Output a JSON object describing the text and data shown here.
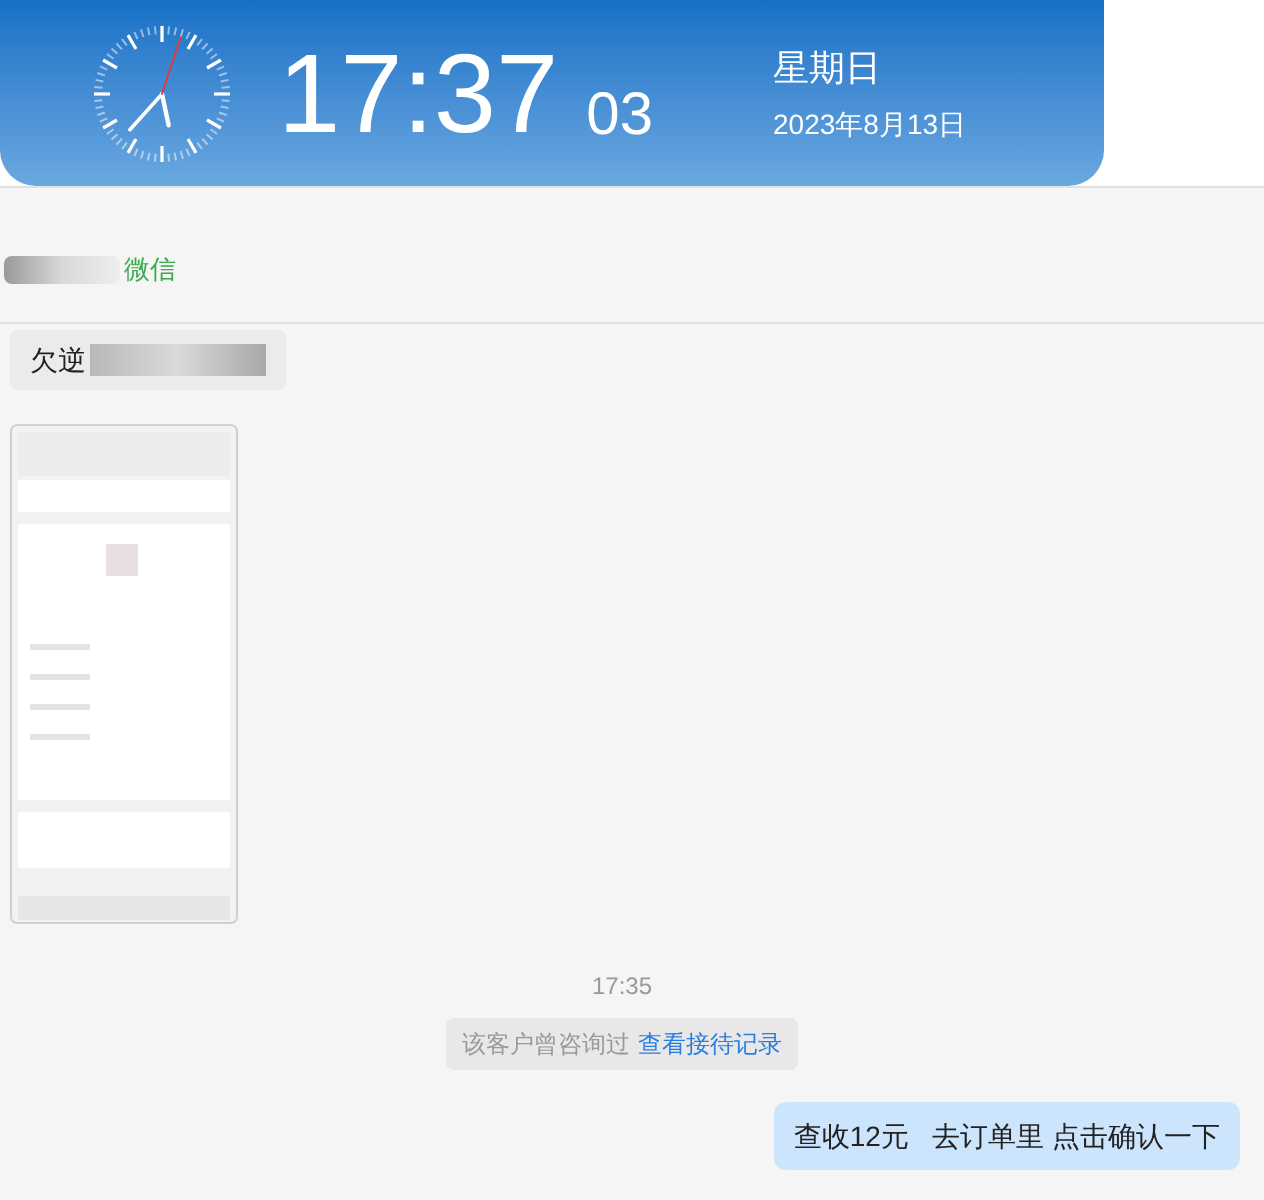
{
  "clock": {
    "time": "17:37",
    "seconds": "03",
    "weekday": "星期日",
    "date": "2023年8月13日"
  },
  "contact": {
    "channel": "微信"
  },
  "messages": [
    {
      "kind": "text_in",
      "text": "欠逆"
    },
    {
      "kind": "picture"
    },
    {
      "kind": "time",
      "text": "17:35"
    },
    {
      "kind": "notice",
      "text": "该客户曾咨询过",
      "link": "查看接待记录"
    },
    {
      "kind": "text_out",
      "text": "查收12元   去订单里 点击确认一下"
    }
  ]
}
